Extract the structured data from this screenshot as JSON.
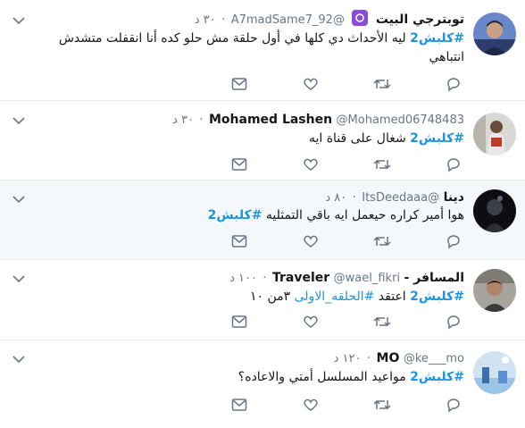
{
  "tweets": [
    {
      "name": "توبترجي البيت",
      "handle": "@A7madSame7_92",
      "time": "٣٠ د",
      "hashtag": "#كلبش2",
      "text": " ليه الأحداث دي كلها في أول حلقة مش حلو كده أنا انقفلت متشدش انتباهي"
    },
    {
      "name": "Mohamed Lashen",
      "handle": "@Mohamed06748483",
      "time": "٣٠ د",
      "hashtag": "#كلبش2",
      "text": " شغال على قناة ايه"
    },
    {
      "name": "دينا",
      "handle": "@ItsDeedaaa",
      "time": "٨٠ د",
      "text": "هوا أمير كراره حيعمل ايه باقي التمثليه ",
      "hashtag": "#كلبش2"
    },
    {
      "name_a": "المسافر -",
      "name_b": "Traveler",
      "handle": "@wael_fikri",
      "time": "١٠٠ د",
      "hashtag": "#كلبش2",
      "text_a": " اعتقد ",
      "link": "#الحلقه_الاولى",
      "text_b": " ٣من ١٠"
    },
    {
      "name": "MO",
      "handle": "@ke___mo",
      "time": "١٢٠ د",
      "hashtag": "#كلبش2",
      "text": " مواعيد المسلسل أمتي والاعاده؟"
    }
  ],
  "colors": {
    "hashtag": "#1b95e0",
    "muted": "#657786",
    "highlight_bg": "#f5f8fa",
    "badge": "#8a4bd8"
  },
  "icons": {
    "reply": "reply-icon",
    "retweet": "retweet-icon",
    "like": "heart-icon",
    "dm": "envelope-icon",
    "more": "chevron-down-icon"
  }
}
